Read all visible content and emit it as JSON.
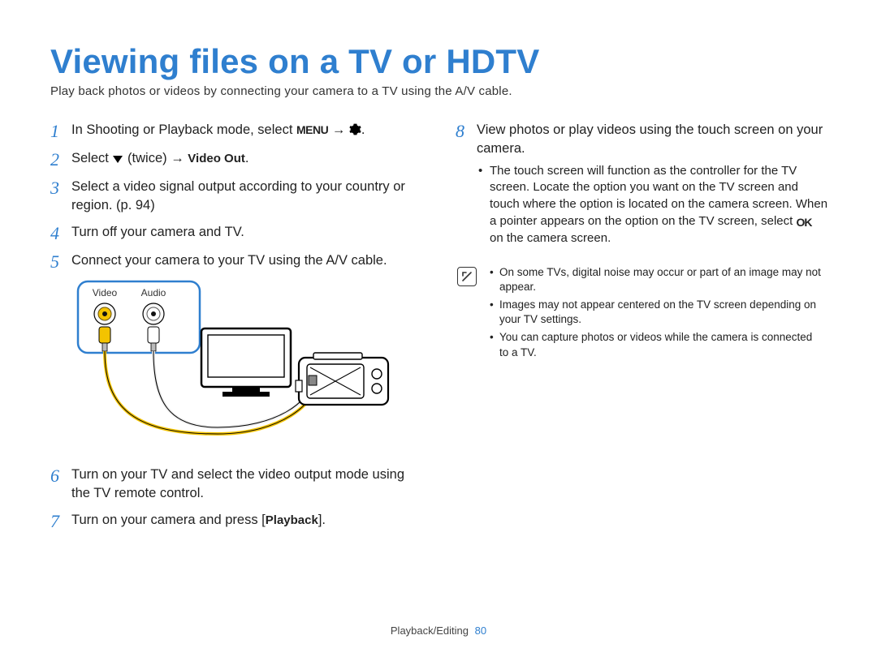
{
  "title": "Viewing files on a TV or HDTV",
  "subtitle": "Play back photos or videos by connecting your camera to a TV using the A/V cable.",
  "steps": {
    "s1": {
      "num": "1",
      "pre": "In Shooting or Playback mode, select ",
      "menu": "MENU",
      "arrow1": " → ",
      "gear_alt": "settings",
      "post": "."
    },
    "s2": {
      "num": "2",
      "pre": "Select ",
      "down_alt": "down",
      "twice": " (twice) → ",
      "bold": "Video Out",
      "post": "."
    },
    "s3": {
      "num": "3",
      "text": "Select a video signal output according to your country or region. (p. 94)"
    },
    "s4": {
      "num": "4",
      "text": "Turn off your camera and TV."
    },
    "s5": {
      "num": "5",
      "text": "Connect your camera to your TV using the A/V cable."
    },
    "s6": {
      "num": "6",
      "text": "Turn on your TV and select the video output mode using the TV remote control."
    },
    "s7": {
      "num": "7",
      "pre": "Turn on your camera and press [",
      "bold": "Playback",
      "post": "]."
    },
    "s8": {
      "num": "8",
      "text": "View photos or play videos using the touch screen on your camera."
    },
    "s8_sub": "The touch screen will function as the controller for the TV screen. Locate the option you want on the TV screen and touch where the option is located on the camera screen. When a pointer appears on the option on the TV screen, select ",
    "s8_sub_ok": "OK",
    "s8_sub_post": " on the camera screen."
  },
  "diagram_labels": {
    "video": "Video",
    "audio": "Audio"
  },
  "notes": {
    "n1": "On some TVs, digital noise may occur or part of an image may not appear.",
    "n2": "Images may not appear centered on the TV screen depending on your TV settings.",
    "n3": "You can capture photos or videos while the camera is connected to a TV."
  },
  "footer": {
    "section": "Playback/Editing",
    "page": "80"
  }
}
